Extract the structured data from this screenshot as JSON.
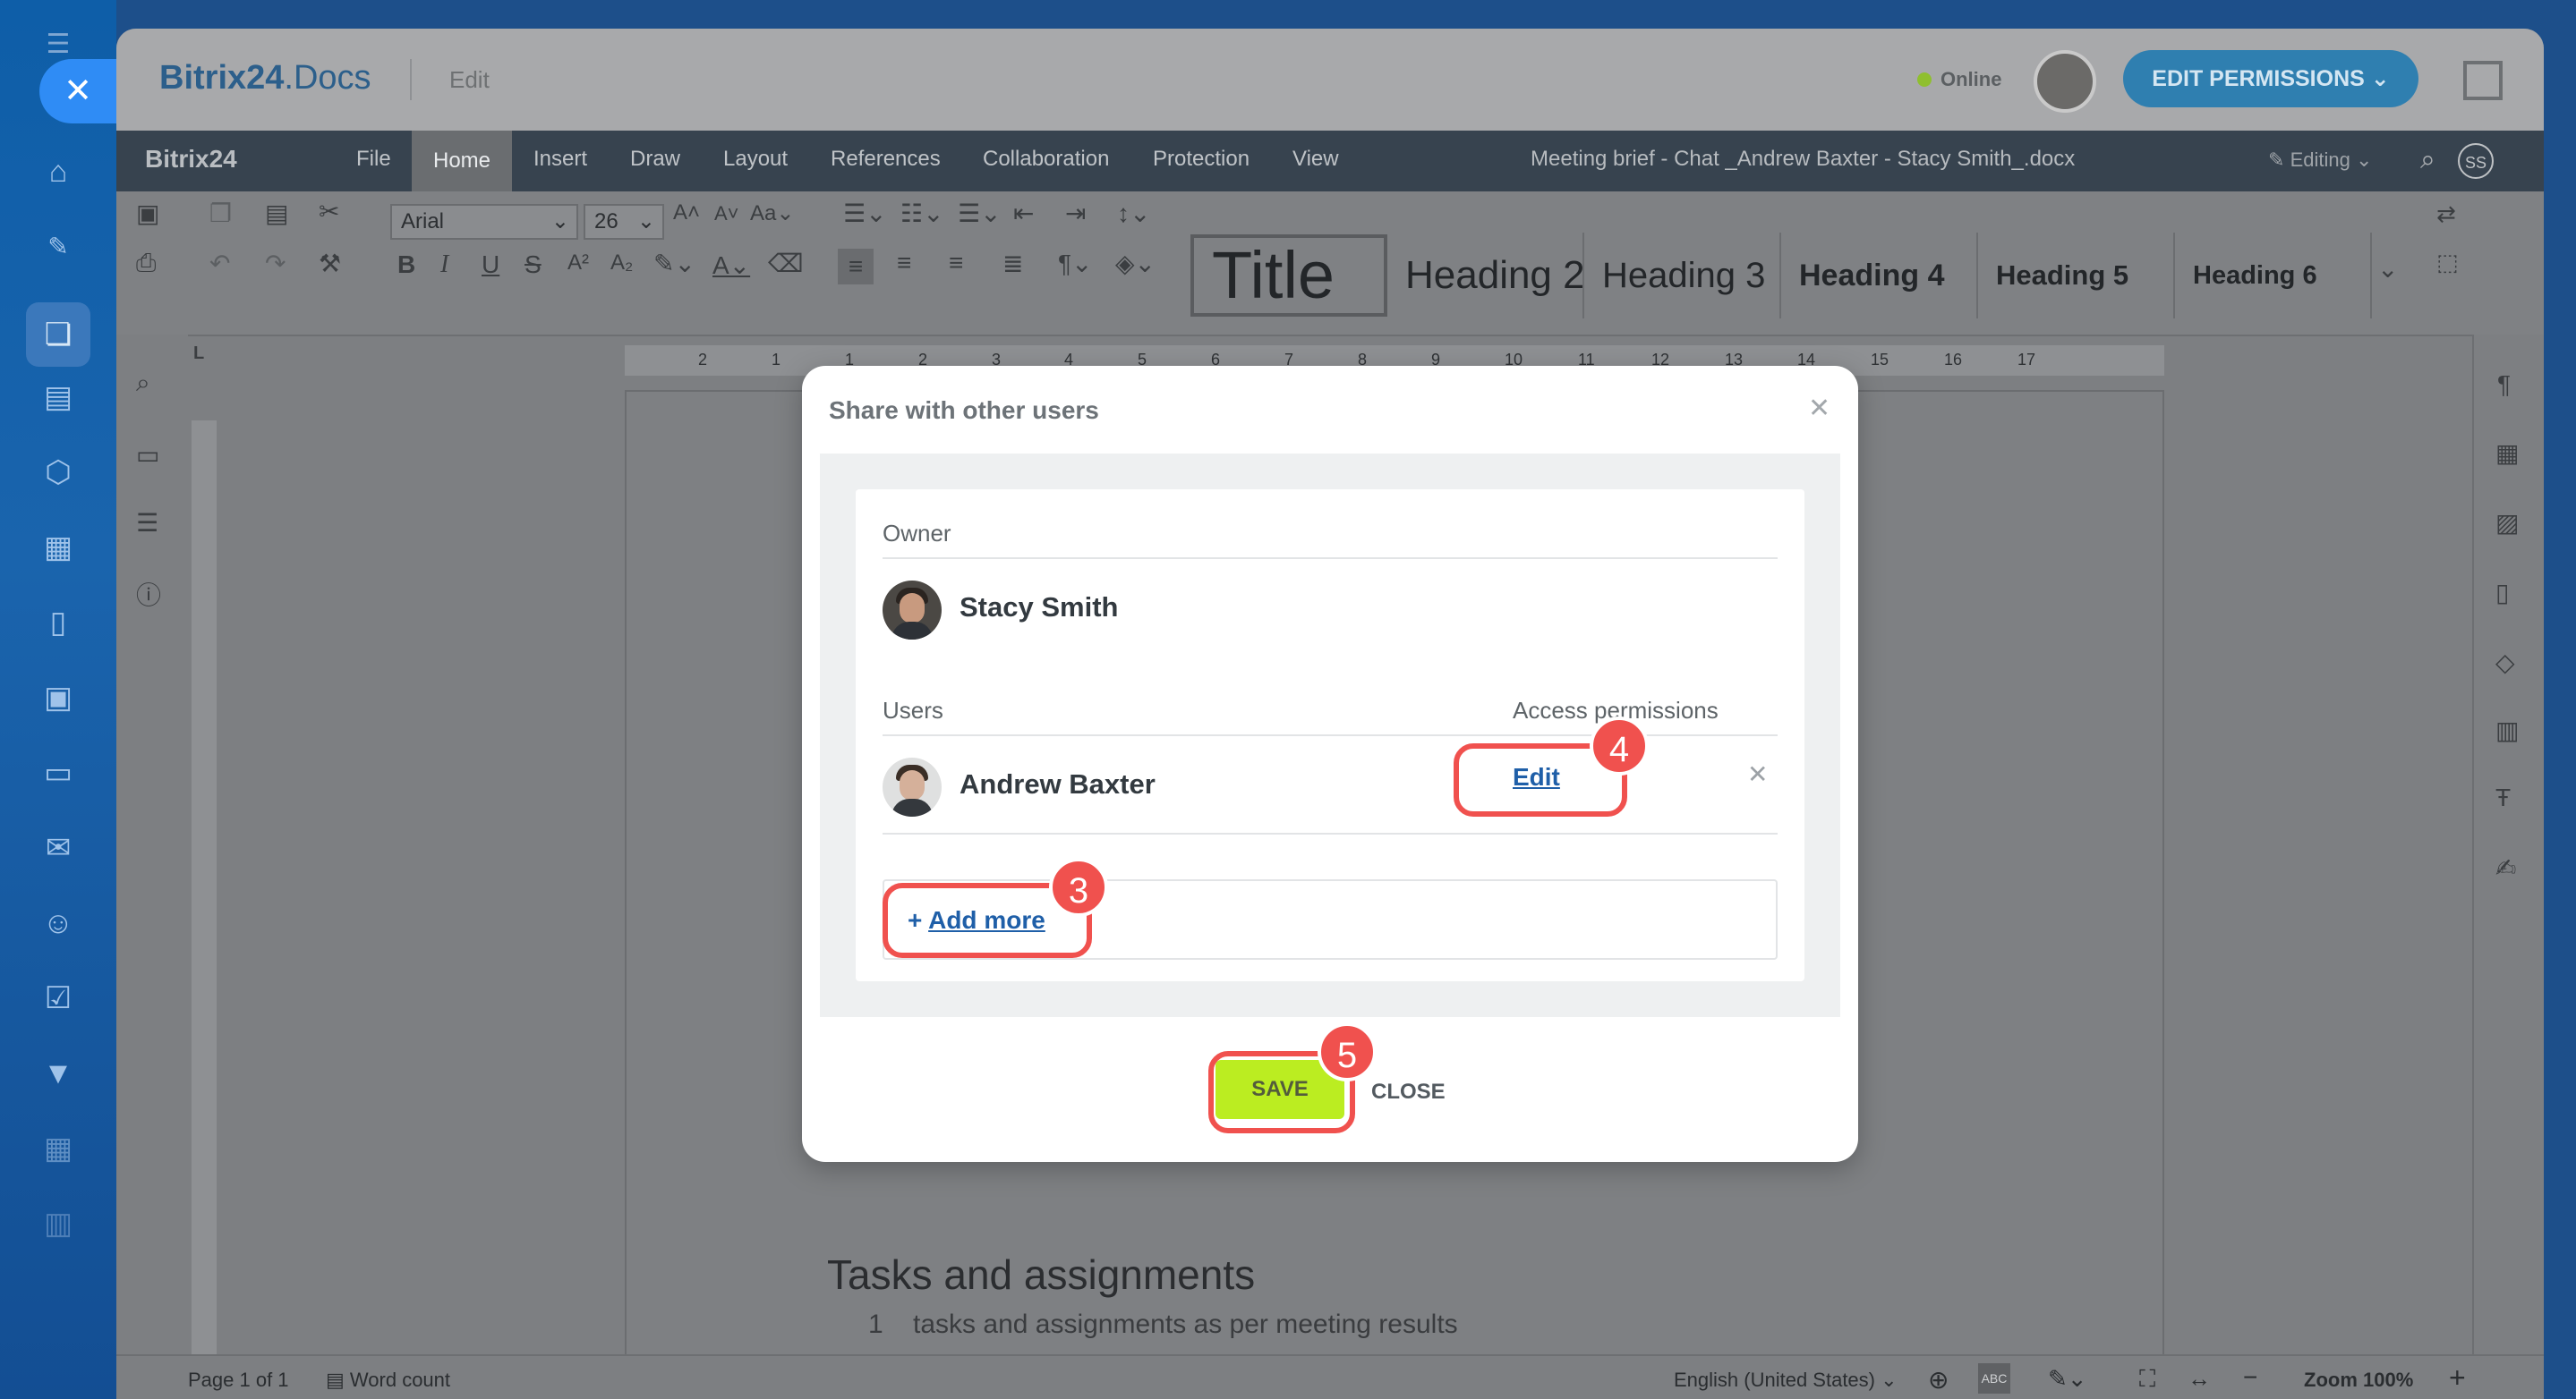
{
  "header": {
    "logo_main": "Bitrix24",
    "logo_suffix": ".Docs",
    "mode": "Edit",
    "status": "Online",
    "permissions_button": "EDIT PERMISSIONS"
  },
  "menu": {
    "brand": "Bitrix24",
    "items": [
      "File",
      "Home",
      "Insert",
      "Draw",
      "Layout",
      "References",
      "Collaboration",
      "Protection",
      "View"
    ],
    "document_title": "Meeting brief - Chat _Andrew Baxter - Stacy Smith_.docx",
    "editing": "Editing",
    "user_initials": "SS"
  },
  "toolbar": {
    "font": "Arial",
    "size": "26",
    "styles": [
      "Title",
      "Heading 2",
      "Heading 3",
      "Heading 4",
      "Heading 5",
      "Heading 6"
    ]
  },
  "ruler": {
    "labels": [
      "2",
      "1",
      "1",
      "2",
      "3",
      "4",
      "5",
      "6",
      "7",
      "8",
      "9",
      "10",
      "11",
      "12",
      "13",
      "14",
      "15",
      "16",
      "17"
    ]
  },
  "document": {
    "heading": "Tasks and assignments",
    "list_item_num": "1",
    "list_item": "tasks and assignments as per meeting results"
  },
  "dialog": {
    "title": "Share with other users",
    "owner_label": "Owner",
    "owner_name": "Stacy Smith",
    "users_label": "Users",
    "permissions_label": "Access permissions",
    "user_name": "Andrew Baxter",
    "user_permission": "Edit",
    "add_more_plus": "+",
    "add_more": "Add more",
    "save": "SAVE",
    "close": "CLOSE"
  },
  "annotations": {
    "add_more_step": "3",
    "edit_step": "4",
    "save_step": "5"
  },
  "statusbar": {
    "page": "Page 1 of 1",
    "word_count": "Word count",
    "language": "English (United States)",
    "zoom": "Zoom 100%"
  },
  "colors": {
    "save": "#bbed21",
    "annotation": "#f0514e",
    "link": "#1f5fa8"
  }
}
